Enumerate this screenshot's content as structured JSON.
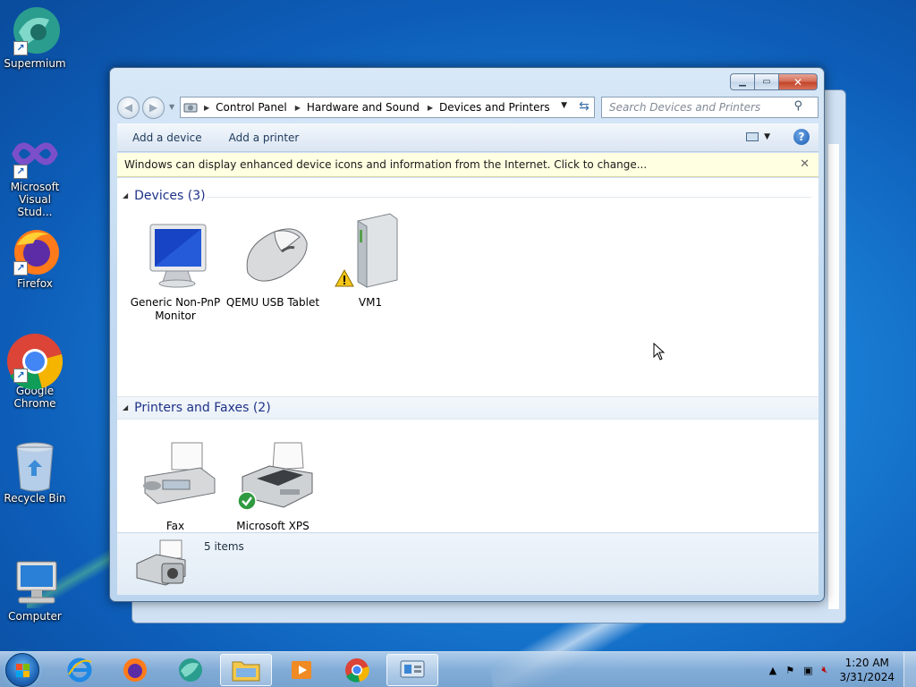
{
  "desktop": {
    "icons": [
      {
        "label": "Supermium"
      },
      {
        "label": "Microsoft Visual Stud..."
      },
      {
        "label": "Firefox"
      },
      {
        "label": "Google Chrome"
      },
      {
        "label": "Recycle Bin"
      },
      {
        "label": "Computer"
      }
    ]
  },
  "window": {
    "caption_buttons": {
      "minimize": "▁",
      "maximize": "▭",
      "close": "✕"
    },
    "nav": {
      "back": "◀",
      "forward": "▶"
    },
    "address": {
      "crumbs": [
        "Control Panel",
        "Hardware and Sound",
        "Devices and Printers"
      ]
    },
    "search": {
      "placeholder": "Search Devices and Printers"
    },
    "commands": {
      "add_device": "Add a device",
      "add_printer": "Add a printer",
      "help": "?"
    },
    "infobar": {
      "text": "Windows can display enhanced device icons and information from the Internet. Click to change...",
      "close": "✕"
    },
    "groups": [
      {
        "title": "Devices (3)",
        "items": [
          {
            "label": "Generic Non-PnP Monitor",
            "icon": "monitor-icon"
          },
          {
            "label": "QEMU USB Tablet",
            "icon": "mouse-icon"
          },
          {
            "label": "VM1",
            "icon": "computer-tower-icon",
            "warning": true
          }
        ]
      },
      {
        "title": "Printers and Faxes (2)",
        "items": [
          {
            "label": "Fax",
            "icon": "fax-icon"
          },
          {
            "label": "Microsoft XPS Document Writer",
            "icon": "printer-icon",
            "default": true
          }
        ]
      }
    ],
    "details": {
      "count": "5 items"
    }
  },
  "taskbar": {
    "clock": {
      "time": "1:20 AM",
      "date": "3/31/2024"
    },
    "pinned": [
      "internet-explorer-icon",
      "firefox-icon",
      "supermium-icon",
      "file-explorer-icon",
      "media-player-icon",
      "chrome-icon",
      "devices-printers-icon"
    ]
  }
}
